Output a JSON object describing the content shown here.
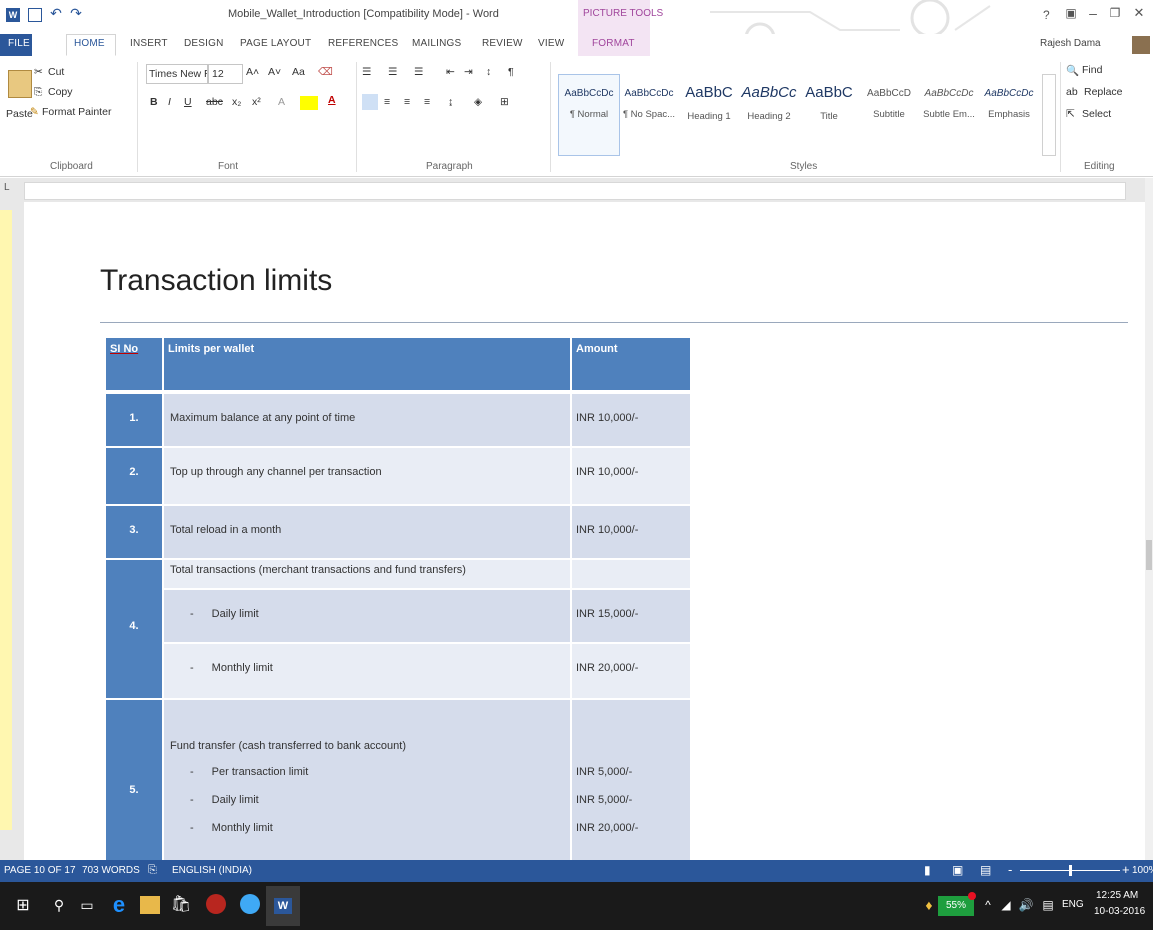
{
  "window": {
    "title": "Mobile_Wallet_Introduction [Compatibility Mode] - Word",
    "contextual_group": "PICTURE TOOLS",
    "help": "?",
    "user": "Rajesh Dama"
  },
  "tabs": [
    "FILE",
    "HOME",
    "INSERT",
    "DESIGN",
    "PAGE LAYOUT",
    "REFERENCES",
    "MAILINGS",
    "REVIEW",
    "VIEW",
    "FORMAT"
  ],
  "ribbon": {
    "clipboard": {
      "paste": "Paste",
      "cut": "Cut",
      "copy": "Copy",
      "format_painter": "Format Painter",
      "group": "Clipboard"
    },
    "font": {
      "name": "Times New Ro",
      "size": "12",
      "case": "Aa",
      "group": "Font"
    },
    "paragraph": {
      "group": "Paragraph"
    },
    "styles": {
      "group": "Styles",
      "items": [
        {
          "preview": "AaBbCcDc",
          "name": "¶ Normal"
        },
        {
          "preview": "AaBbCcDc",
          "name": "¶ No Spac..."
        },
        {
          "preview": "AaBbC",
          "name": "Heading 1"
        },
        {
          "preview": "AaBbCc",
          "name": "Heading 2"
        },
        {
          "preview": "AaBbC",
          "name": "Title"
        },
        {
          "preview": "AaBbCcD",
          "name": "Subtitle"
        },
        {
          "preview": "AaBbCcDc",
          "name": "Subtle Em..."
        },
        {
          "preview": "AaBbCcDc",
          "name": "Emphasis"
        }
      ]
    },
    "editing": {
      "find": "Find",
      "replace": "Replace",
      "select": "Select",
      "group": "Editing"
    }
  },
  "document": {
    "heading": "Transaction limits",
    "table": {
      "headers": [
        "SI No",
        "Limits per wallet",
        "Amount"
      ],
      "rows": [
        {
          "no": "1.",
          "limit": "Maximum balance at any point of time",
          "amount": "INR 10,000/-"
        },
        {
          "no": "2.",
          "limit": "Top up through any channel per transaction",
          "amount": "INR 10,000/-"
        },
        {
          "no": "3.",
          "limit": "Total reload in a month",
          "amount": "INR 10,000/-"
        },
        {
          "no": "4.",
          "limit": "Total transactions (merchant transactions and fund transfers)",
          "amount": "",
          "subitems": [
            {
              "label": "Daily limit",
              "amount": "INR 15,000/-"
            },
            {
              "label": "Monthly limit",
              "amount": "INR 20,000/-"
            }
          ]
        },
        {
          "no": "5.",
          "limit": "Fund transfer (cash transferred to bank account)",
          "amount": "",
          "subitems": [
            {
              "label": "Per transaction limit",
              "amount": "INR 5,000/-"
            },
            {
              "label": "Daily limit",
              "amount": "INR 5,000/-"
            },
            {
              "label": "Monthly limit",
              "amount": "INR 20,000/-"
            }
          ]
        }
      ],
      "dash": "-"
    }
  },
  "status": {
    "page": "PAGE 10 OF 17",
    "words": "703 WORDS",
    "language": "ENGLISH (INDIA)",
    "zoom": "100%"
  },
  "taskbar": {
    "battery": "55%",
    "lang": "ENG",
    "time": "12:25 AM",
    "date": "10-03-2016"
  },
  "colors": {
    "accent": "#2b579a",
    "table_header": "#4f81bd",
    "row_light": "#d5dceb",
    "row_lighter": "#e9edf5"
  }
}
